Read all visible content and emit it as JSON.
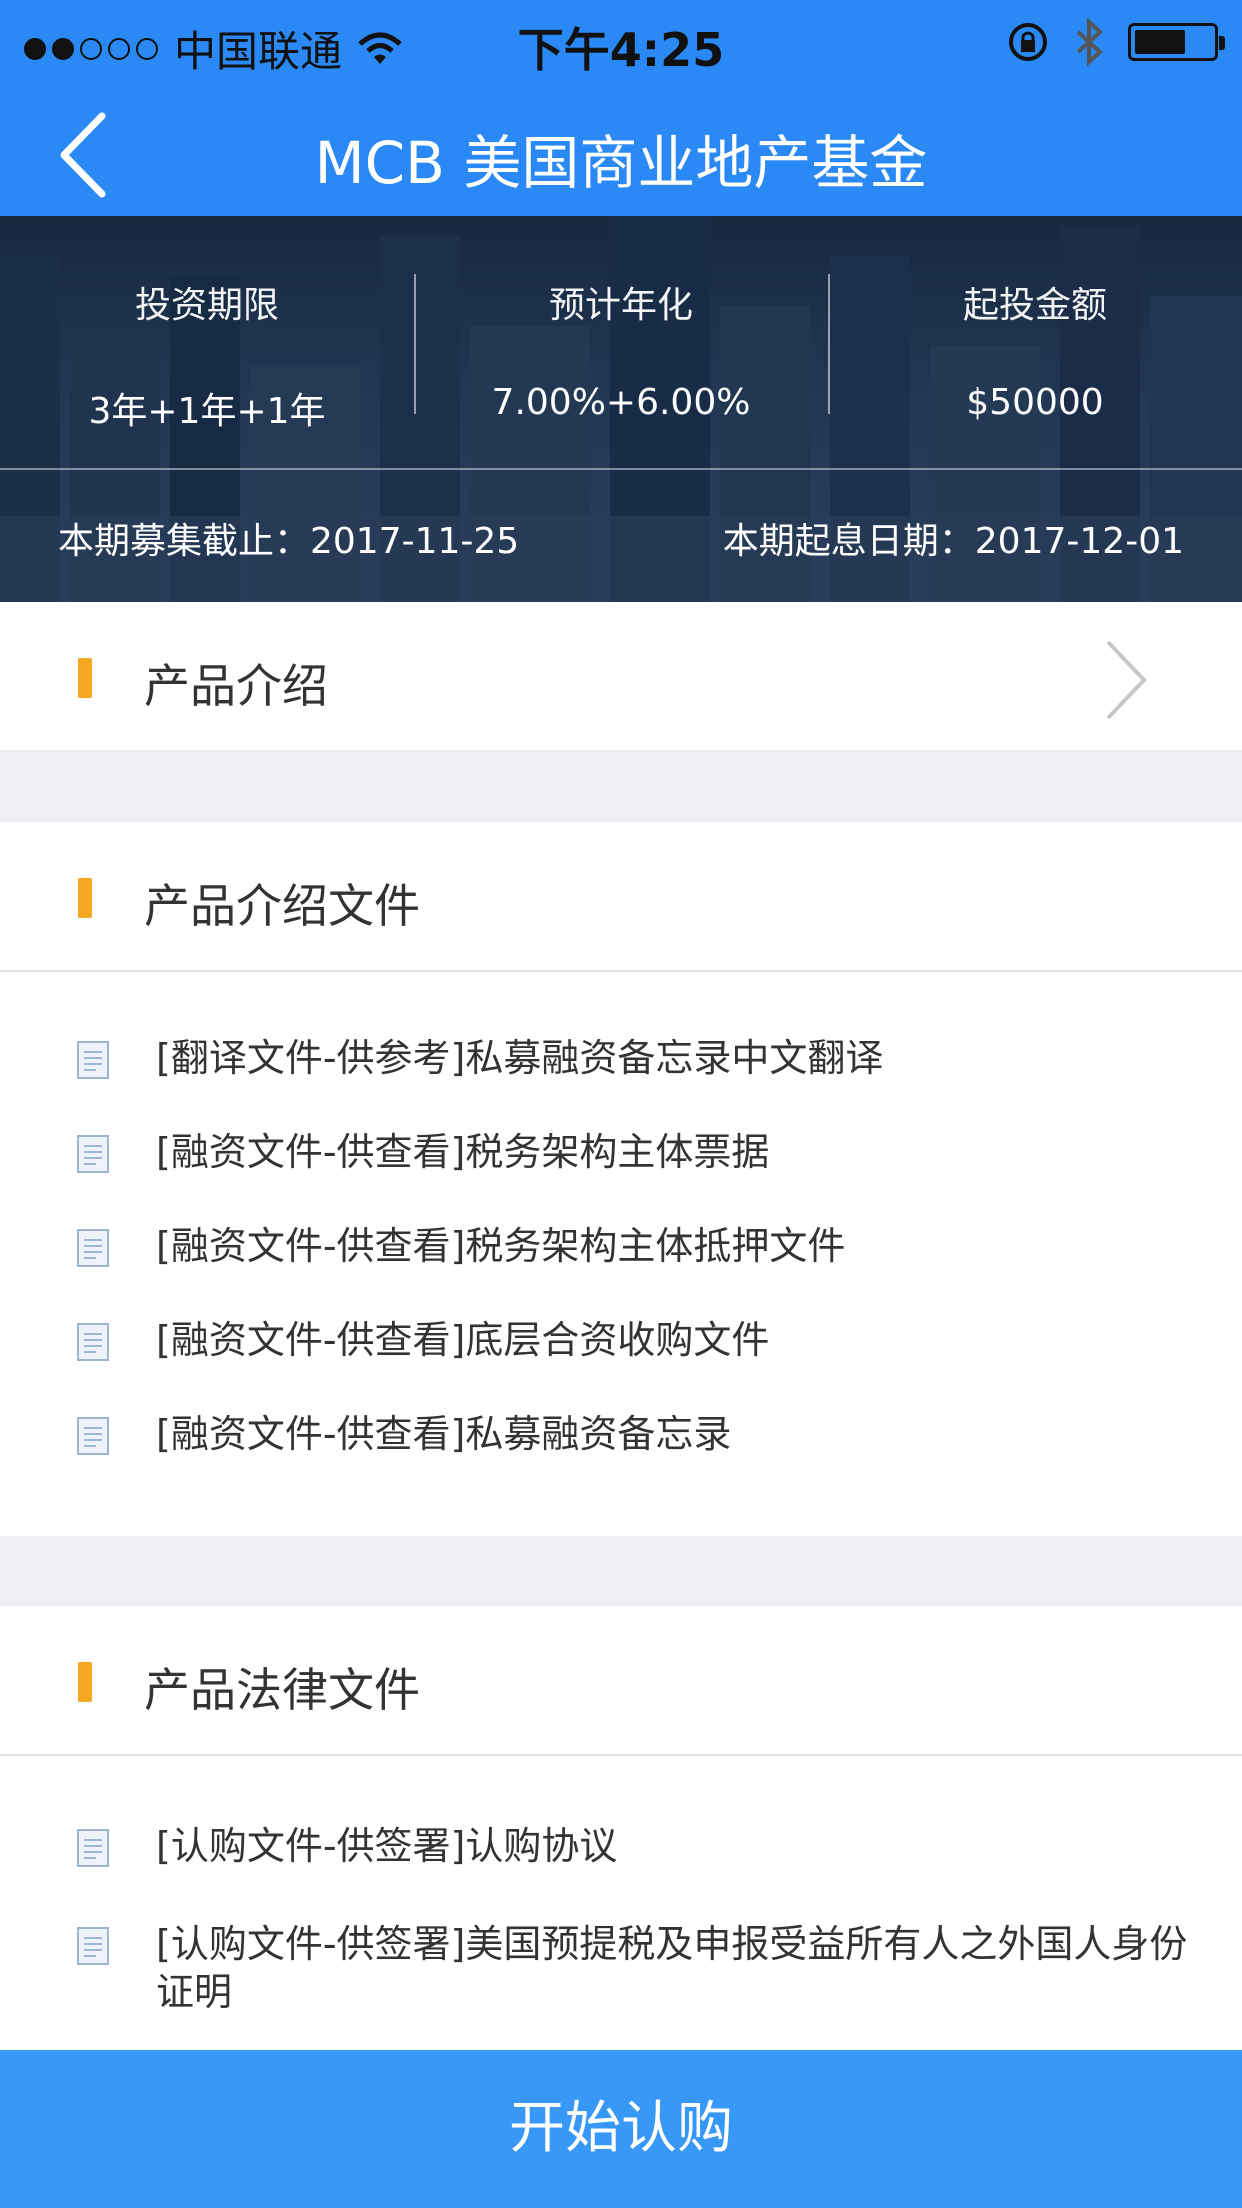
{
  "status": {
    "carrier": "中国联通",
    "time": "下午4:25"
  },
  "nav": {
    "title": "MCB 美国商业地产基金"
  },
  "summary": {
    "stats": [
      {
        "label": "投资期限",
        "value": "3年+1年+1年"
      },
      {
        "label": "预计年化",
        "value": "7.00%+6.00%"
      },
      {
        "label": "起投金额",
        "value": "$50000"
      }
    ],
    "raise_deadline": "本期募集截止：2017-11-25",
    "interest_start": "本期起息日期：2017-12-01"
  },
  "sections": {
    "intro": {
      "title": "产品介绍"
    },
    "intro_docs": {
      "title": "产品介绍文件",
      "items": [
        "[翻译文件-供参考]私募融资备忘录中文翻译",
        "[融资文件-供查看]税务架构主体票据",
        "[融资文件-供查看]税务架构主体抵押文件",
        "[融资文件-供查看]底层合资收购文件",
        "[融资文件-供查看]私募融资备忘录"
      ]
    },
    "legal_docs": {
      "title": "产品法律文件",
      "items": [
        "[认购文件-供签署]认购协议",
        "[认购文件-供签署]美国预提税及申报受益所有人之外国人身份证明"
      ]
    }
  },
  "cta": {
    "label": "开始认购"
  },
  "colors": {
    "nav": "#2b89f5",
    "accent_bar": "#f7a823",
    "cta": "#3798f7"
  }
}
